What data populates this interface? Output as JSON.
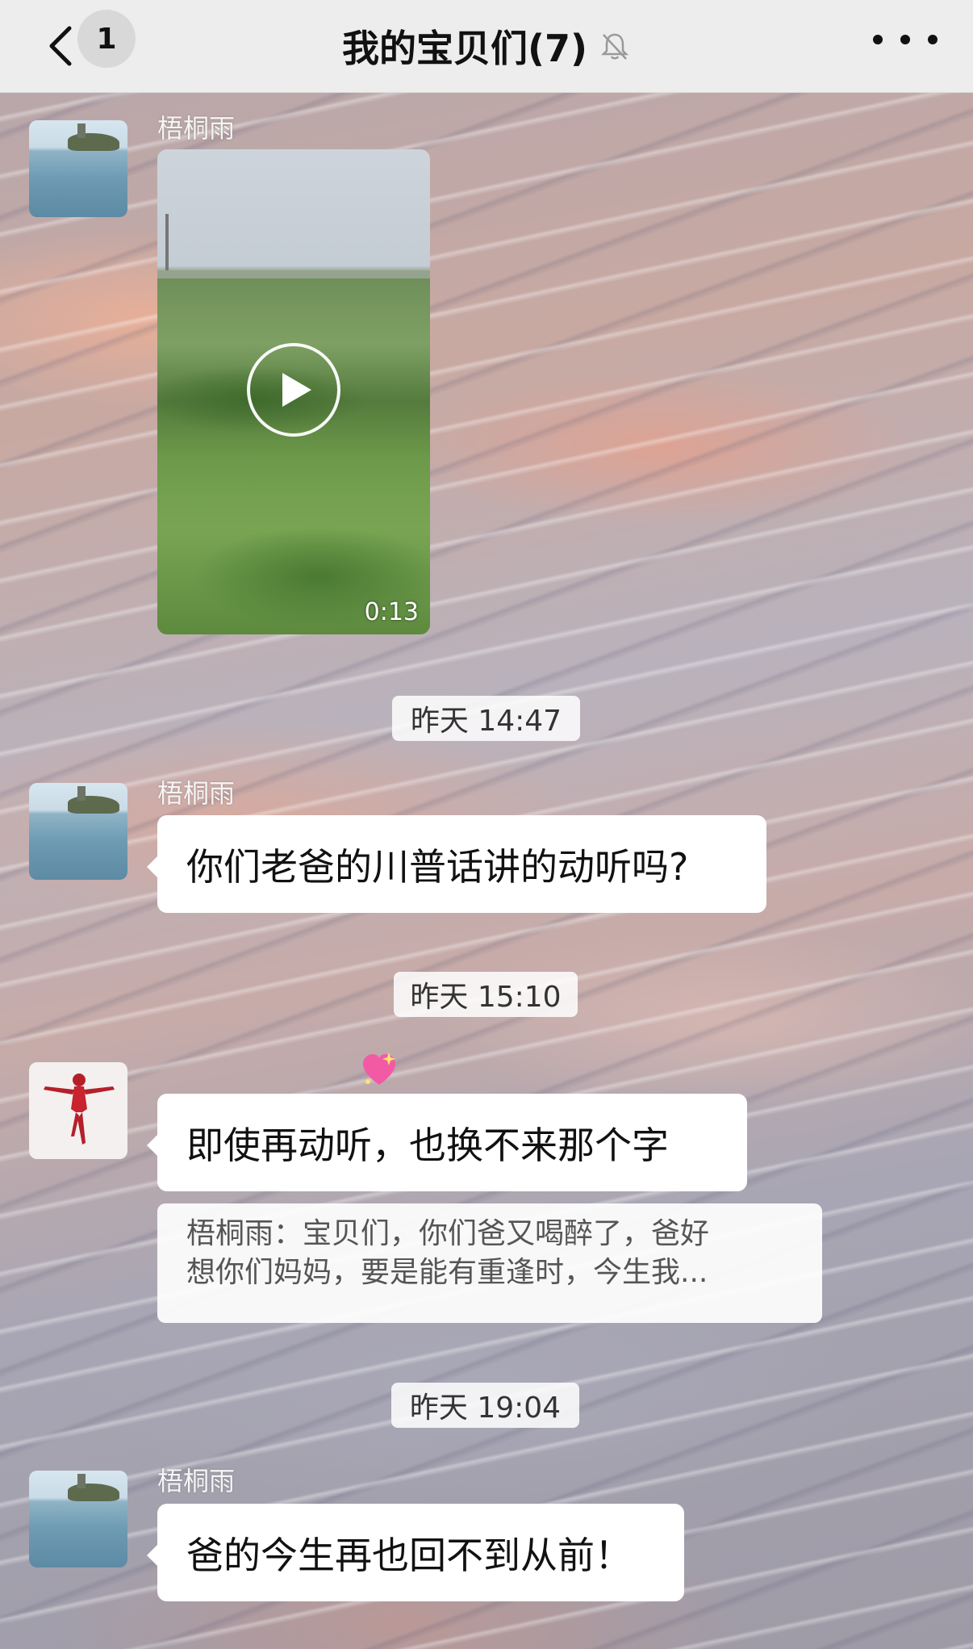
{
  "header": {
    "unread_count": "1",
    "title": "我的宝贝们(7)"
  },
  "messages": [
    {
      "sender": "梧桐雨",
      "type": "video",
      "duration": "0:13"
    },
    {
      "timestamp": "昨天 14:47"
    },
    {
      "sender": "梧桐雨",
      "type": "text",
      "text": "你们老爸的川普话讲的动听吗?"
    },
    {
      "timestamp": "昨天 15:10"
    },
    {
      "sender": "",
      "type": "text",
      "text": "即使再动听，也换不来那个字",
      "quote_line1": "梧桐雨：宝贝们，你们爸又喝醉了，爸好",
      "quote_line2": "想你们妈妈，要是能有重逢时，今生我..."
    },
    {
      "timestamp": "昨天 19:04"
    },
    {
      "sender": "梧桐雨",
      "type": "text",
      "text": "爸的今生再也回不到从前！"
    }
  ],
  "colors": {
    "header_bg": "#ededed",
    "bubble_bg": "#ffffff"
  },
  "icons": [
    "back-chevron-icon",
    "mute-bell-icon",
    "more-dots-icon",
    "play-icon",
    "sparkle-heart-icon"
  ]
}
